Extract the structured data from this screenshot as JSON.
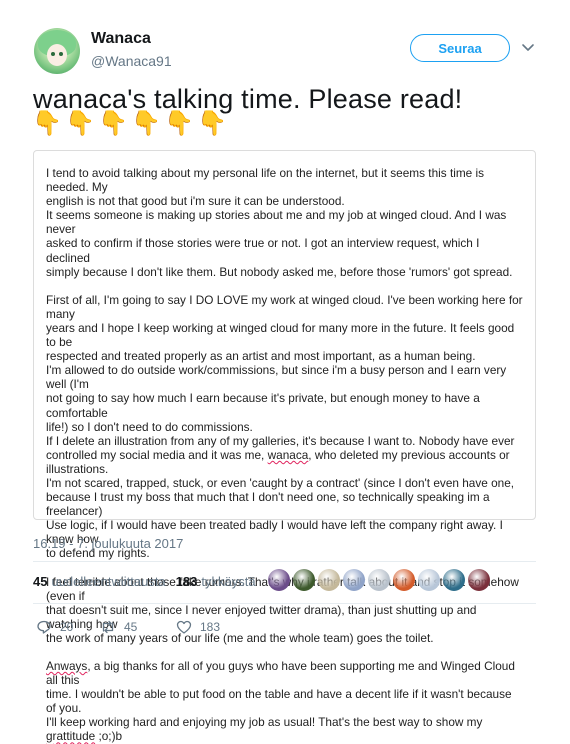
{
  "author": {
    "display_name": "Wanaca",
    "handle": "@Wanaca91"
  },
  "follow_label": "Seuraa",
  "tweet_text": "wanaca's talking time. Please read!",
  "emoji": [
    "👇",
    "👇",
    "👇",
    "👇",
    "👇",
    "👇"
  ],
  "note": {
    "p1": "I tend to avoid talking about my personal life on the internet, but it seems this time is needed. My\nenglish is not that good but i'm sure it can be understood.\nIt seems someone is making up stories about me and my job at winged cloud. And I was never\nasked to confirm if those stories were true or not. I got an interview request, which I declined\nsimply because I don't like them. But nobody asked me, before those 'rumors' got spread.",
    "p2a": "First of all, I'm going to say I DO LOVE my work at winged cloud. I've been working here for many\nyears and I hope I keep working at winged cloud for many more in the future. It feels good to be\nrespected and treated properly as an artist and most important, as a human being.\nI'm allowed to do outside work/commissions, but since i'm a busy person and I earn very well (I'm\nnot going to say how much I earn because it's private, but enough money to have a comfortable\nlife!) so I don't need to do commissions.\nIf I delete an illustration from any of my galleries, it's because I want to. Nobody have ever\ncontrolled my social media and it was me, ",
    "p2_word": "wanaca",
    "p2b": ", who deleted my previous accounts or\nillustrations.\nI'm not scared, trapped, stuck, or even 'caught by a contract' (since I don't even have one,\nbecause I trust my boss that much that I don't need one, so technically speaking im a freelancer)\nUse logic, if I would have been treated badly I would have left the company right away. I know how\nto defend my rights.",
    "p3": "I feel terrible about those fake rumors. That's why i rather talk about it and stop it somehow (even if\nthat doesn't suit me, since I never enjoyed twitter drama), than just shutting up and watching how\nthe work of many years of our life (me and the whole team) goes the toilet.",
    "p4_word1": "Anways",
    "p4a": ", a big thanks for all of you guys who have been supporting me and Winged Cloud all this\ntime. I wouldn't be able to put food on the table and have a decent life if it wasn't because of you.\nI'll keep working hard and enjoying my job as usual! That's the best way to show my ",
    "p4_word2": "grattitude",
    "p4b": " ;o;)b"
  },
  "timestamp": "16.19 - 7. joulukuuta 2017",
  "stats": {
    "retweets_count": "45",
    "retweets_label": "uudelleentwiittausta",
    "likes_count": "183",
    "likes_label": "tykkäystä"
  },
  "liker_colors": [
    "#6b4c8a",
    "#3d5a2c",
    "#c4b89a",
    "#8fa3c8",
    "#b9c2cc",
    "#d35b2a",
    "#b7c6d8",
    "#2d6d8a",
    "#7a2f3a"
  ],
  "actions": {
    "replies": "20",
    "retweets": "45",
    "likes": "183"
  },
  "colors": {
    "accent": "#1da1f2",
    "muted": "#657786"
  }
}
